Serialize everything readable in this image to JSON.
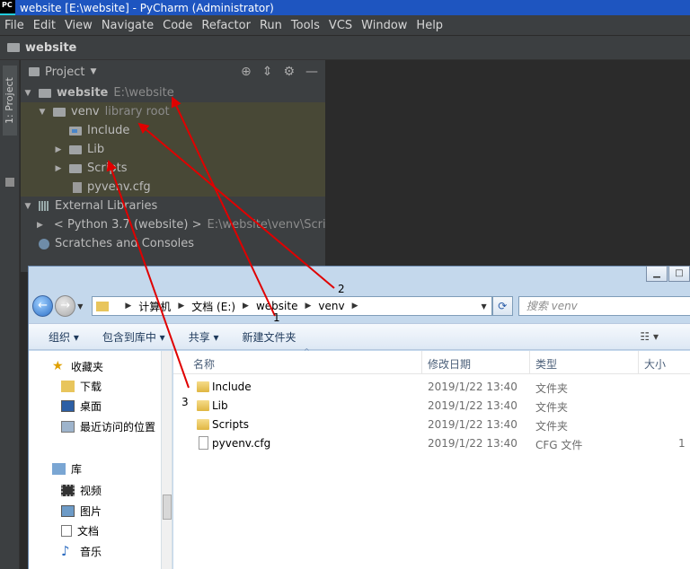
{
  "window": {
    "title": "website [E:\\website] - PyCharm (Administrator)",
    "logo": "PC"
  },
  "menu": [
    "File",
    "Edit",
    "View",
    "Navigate",
    "Code",
    "Refactor",
    "Run",
    "Tools",
    "VCS",
    "Window",
    "Help"
  ],
  "breadcrumb": "website",
  "side_tab": "1: Project",
  "project_panel": {
    "title": "Project",
    "icons": [
      "target-icon",
      "collapse-icon",
      "gear-icon",
      "minimize-icon"
    ]
  },
  "tree": [
    {
      "name": "website",
      "extra": "E:\\website"
    },
    {
      "name": "venv",
      "extra": "library root"
    },
    {
      "name": "Include"
    },
    {
      "name": "Lib"
    },
    {
      "name": "Scripts"
    },
    {
      "name": "pyvenv.cfg"
    },
    {
      "name": "External Libraries"
    },
    {
      "name": "< Python 3.7 (website) >",
      "extra": "E:\\website\\venv\\Scripts"
    },
    {
      "name": "Scratches and Consoles"
    }
  ],
  "explorer": {
    "address": [
      "计算机",
      "文档 (E:)",
      "website",
      "venv"
    ],
    "search_placeholder": "搜索 venv",
    "toolbar": [
      "组织 ▾",
      "包含到库中 ▾",
      "共享 ▾",
      "新建文件夹"
    ],
    "nav": [
      "收藏夹",
      "下载",
      "桌面",
      "最近访问的位置",
      "库",
      "视频",
      "图片",
      "文档",
      "音乐"
    ],
    "columns": [
      "名称",
      "修改日期",
      "类型",
      "大小"
    ],
    "files": [
      {
        "name": "Include",
        "date": "2019/1/22 13:40",
        "type": "文件夹",
        "size": ""
      },
      {
        "name": "Lib",
        "date": "2019/1/22 13:40",
        "type": "文件夹",
        "size": ""
      },
      {
        "name": "Scripts",
        "date": "2019/1/22 13:40",
        "type": "文件夹",
        "size": ""
      },
      {
        "name": "pyvenv.cfg",
        "date": "2019/1/22 13:40",
        "type": "CFG 文件",
        "size": "1"
      }
    ]
  },
  "annotations": {
    "labels": [
      "1",
      "2",
      "3"
    ],
    "color": "#e00000"
  }
}
